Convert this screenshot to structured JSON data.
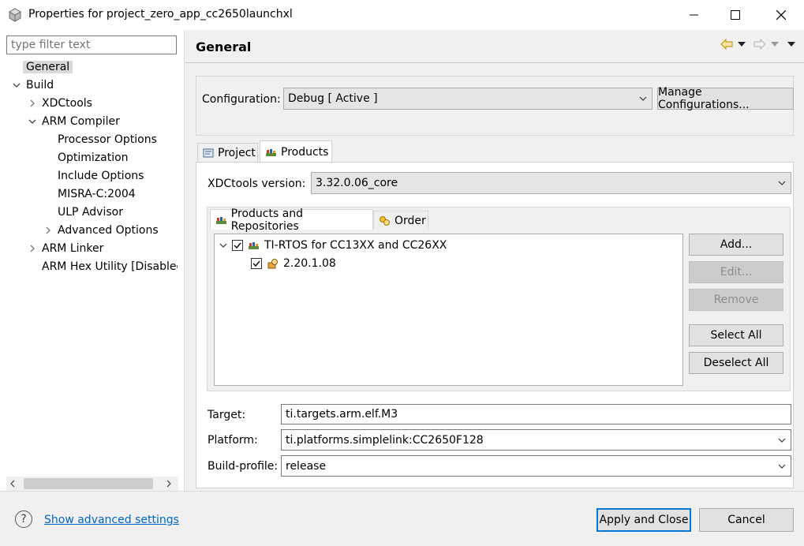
{
  "window": {
    "title": "Properties for project_zero_app_cc2650launchxl",
    "minimize_icon": "minimize-icon",
    "maximize_icon": "maximize-icon",
    "close_icon": "close-icon"
  },
  "left": {
    "filter_placeholder": "type filter text",
    "tree": [
      {
        "label": "General",
        "selected": true
      },
      {
        "label": "Build",
        "expanded": true
      },
      {
        "label": "XDCtools",
        "collapsed": true
      },
      {
        "label": "ARM Compiler",
        "expanded": true
      },
      {
        "label": "Processor Options"
      },
      {
        "label": "Optimization"
      },
      {
        "label": "Include Options"
      },
      {
        "label": "MISRA-C:2004"
      },
      {
        "label": "ULP Advisor"
      },
      {
        "label": "Advanced Options",
        "collapsed": true
      },
      {
        "label": "ARM Linker",
        "collapsed": true
      },
      {
        "label": "ARM Hex Utility  [Disabled]"
      }
    ]
  },
  "right": {
    "page_title": "General",
    "configuration_label": "Configuration:",
    "configuration_value": "Debug  [ Active ]",
    "manage_configurations": "Manage Configurations...",
    "tabs": [
      {
        "label": "Project"
      },
      {
        "label": "Products",
        "active": true
      }
    ],
    "xdctools_label": "XDCtools version:",
    "xdctools_value": "3.32.0.06_core",
    "subtabs": [
      {
        "label": "Products and Repositories",
        "active": true
      },
      {
        "label": "Order"
      }
    ],
    "products": [
      {
        "label": "TI-RTOS for CC13XX and CC26XX",
        "checked": true
      },
      {
        "label": "2.20.1.08",
        "checked": true
      }
    ],
    "buttons": {
      "add": "Add...",
      "edit": "Edit...",
      "remove": "Remove",
      "select_all": "Select All",
      "deselect_all": "Deselect All"
    },
    "target_label": "Target:",
    "target_value": "ti.targets.arm.elf.M3",
    "platform_label": "Platform:",
    "platform_value": "ti.platforms.simplelink:CC2650F128",
    "build_profile_label": "Build-profile:",
    "build_profile_value": "release"
  },
  "bottom": {
    "help_symbol": "?",
    "show_advanced": "Show advanced settings",
    "apply_close": "Apply and Close",
    "cancel": "Cancel"
  },
  "colors": {
    "link": "#0066cc",
    "accent": "#0078d7"
  }
}
